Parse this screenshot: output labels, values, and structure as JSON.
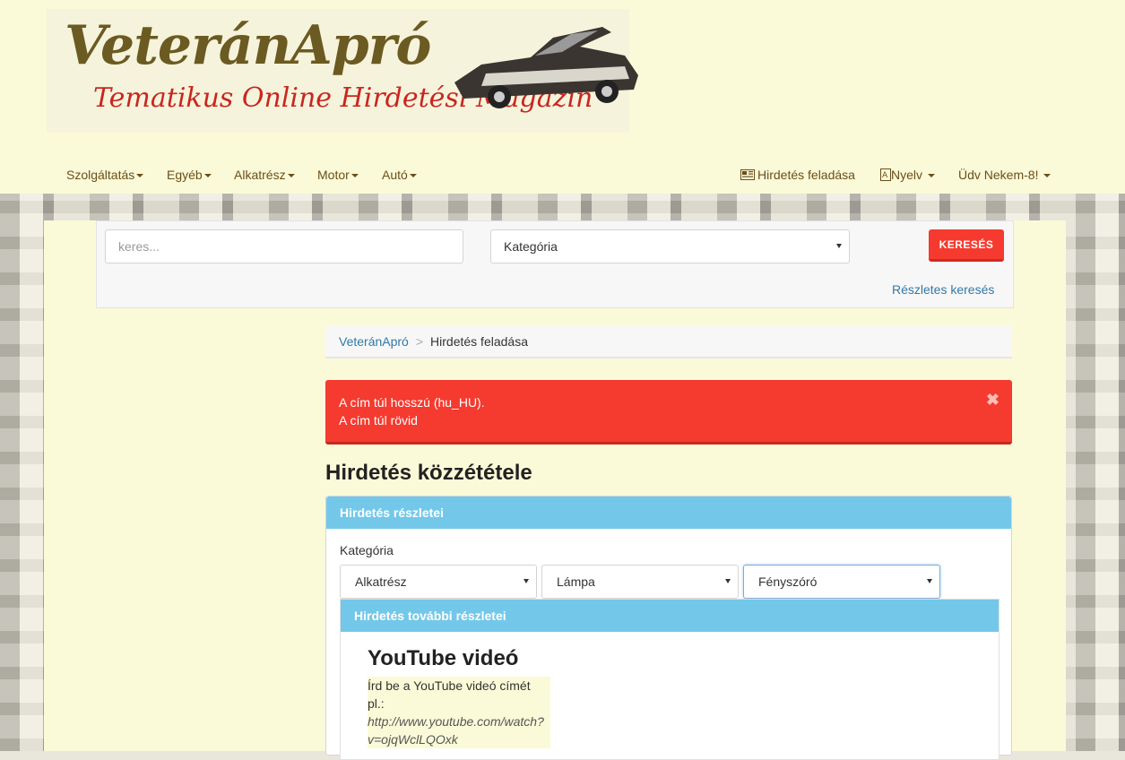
{
  "logo": {
    "title": "VeteránApró",
    "subtitle": "Tematikus Online Hirdetési Magazin"
  },
  "nav": {
    "left_items": [
      {
        "label": "Szolgáltatás"
      },
      {
        "label": "Egyéb"
      },
      {
        "label": "Alkatrész"
      },
      {
        "label": "Motor"
      },
      {
        "label": "Autó"
      }
    ],
    "post_ad": "Hirdetés feladása",
    "language": "Nyelv",
    "user": "Üdv Nekem-8!"
  },
  "search": {
    "placeholder": "keres...",
    "category_value": "Kategória",
    "button": "KERESÉS",
    "advanced_link": "Részletes keresés"
  },
  "breadcrumb": {
    "home": "VeteránApró",
    "separator": ">",
    "current": "Hirdetés feladása"
  },
  "alert": {
    "line1": "A cím túl hosszú (hu_HU).",
    "line2": "A cím túl rövid",
    "close": "✖"
  },
  "form": {
    "heading": "Hirdetés közzététele",
    "panel_title": "Hirdetés részletei",
    "category_label": "Kategória",
    "category_1": "Alkatrész",
    "category_2": "Lámpa",
    "category_3": "Fényszóró",
    "subpanel_title": "Hirdetés további részletei",
    "youtube_heading": "YouTube videó",
    "youtube_help": "Írd be a YouTube videó címét pl.:",
    "youtube_example": "http://www.youtube.com/watch?v=ojqWclLQOxk"
  },
  "colors": {
    "header_bg": "#fbfad8",
    "accent_red": "#f53a2f",
    "panel_blue": "#73c8ea",
    "link_blue": "#3279a8",
    "logo_brown": "#6b5a21"
  }
}
